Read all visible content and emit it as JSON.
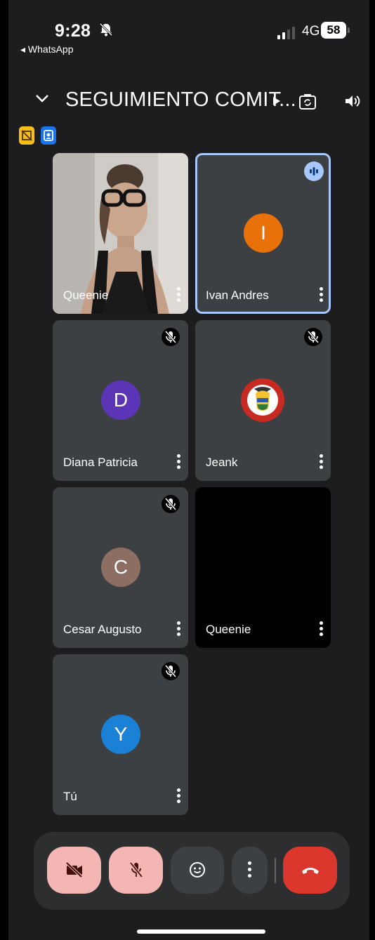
{
  "status_bar": {
    "time": "9:28",
    "back_app": "◂ WhatsApp",
    "network": "4G",
    "battery": "58"
  },
  "meeting": {
    "title": "SEGUIMIENTO COMIT..."
  },
  "participants": [
    {
      "name": "Queenie"
    },
    {
      "name": "Ivan Andres",
      "initial": "I"
    },
    {
      "name": "Diana Patricia",
      "initial": "D"
    },
    {
      "name": "Jeank"
    },
    {
      "name": "Cesar Augusto",
      "initial": "C"
    },
    {
      "name": "Queenie"
    },
    {
      "name": "Tú",
      "initial": "Y"
    }
  ],
  "colors": {
    "tile": "#3c4043",
    "active_border": "#a8c7fa",
    "avatar_ivan": "#e8710a",
    "avatar_diana": "#5b35b5",
    "avatar_cesar": "#8d6e63",
    "avatar_you": "#1a81d6",
    "btn_off": "#f4b6b2",
    "end_call": "#db372d"
  },
  "icons": [
    "mute-icon",
    "speaking-icon",
    "kebab-icon",
    "camera-off-icon",
    "mic-off-icon",
    "emoji-icon",
    "more-icon",
    "end-call-icon",
    "chevron-down-icon",
    "speaker-icon",
    "camera-flip-icon"
  ]
}
